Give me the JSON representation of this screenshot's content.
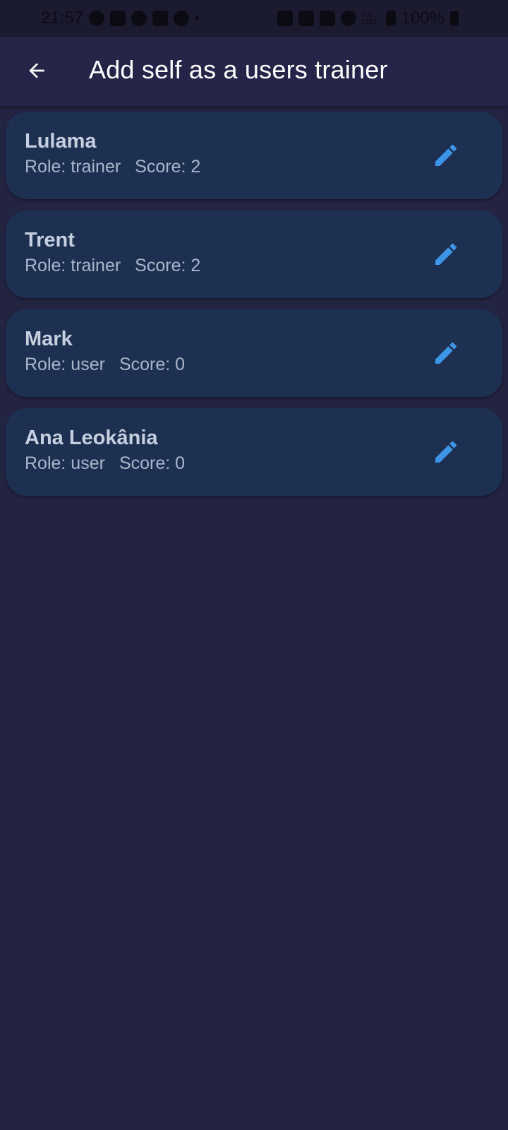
{
  "status_bar": {
    "time": "21:57",
    "battery_percent": "100%",
    "network_label": "Vo)) LTE1"
  },
  "app_bar": {
    "title": "Add self as a users trainer",
    "back_icon": "arrow-back-icon"
  },
  "colors": {
    "background": "#232342",
    "app_bar": "#25254a",
    "card": "#1e3052",
    "accent": "#3d95e8"
  },
  "users": [
    {
      "name": "Lulama",
      "role": "Role: trainer",
      "score": "Score: 2",
      "action_icon": "edit-icon"
    },
    {
      "name": "Trent",
      "role": "Role: trainer",
      "score": "Score: 2",
      "action_icon": "edit-icon"
    },
    {
      "name": "Mark",
      "role": "Role: user",
      "score": "Score: 0",
      "action_icon": "edit-icon"
    },
    {
      "name": "Ana Leokânia",
      "role": "Role: user",
      "score": "Score: 0",
      "action_icon": "edit-icon"
    }
  ]
}
